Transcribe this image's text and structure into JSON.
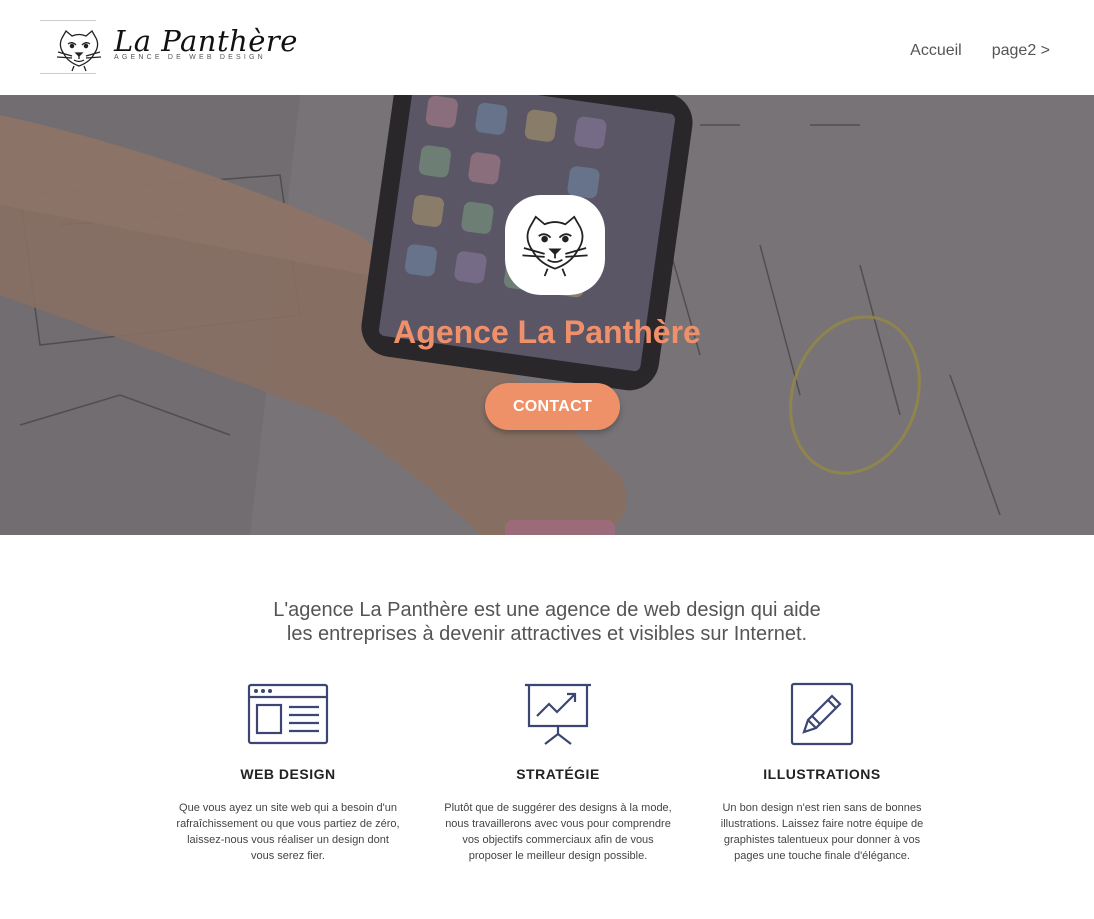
{
  "brand": {
    "name": "La Panthère",
    "tagline": "AGENCE DE WEB DESIGN"
  },
  "nav": {
    "items": [
      {
        "label": "Accueil"
      },
      {
        "label": "page2 >"
      }
    ]
  },
  "hero": {
    "title": "Agence La Panthère",
    "button_label": "CONTACT"
  },
  "intro": {
    "line1": "L'agence La Panthère est une agence de web design qui aide",
    "line2": "les entreprises à devenir attractives et visibles sur Internet."
  },
  "features": [
    {
      "icon": "browser-window-icon",
      "title": "WEB DESIGN",
      "text": "Que vous ayez un site web qui a besoin d'un rafraîchissement ou que vous partiez de zéro, laissez-nous vous réaliser un design dont vous serez fier."
    },
    {
      "icon": "presentation-chart-icon",
      "title": "STRATÉGIE",
      "text": "Plutôt que de suggérer des designs à la mode, nous travaillerons avec vous pour comprendre vos objectifs commerciaux afin de vous proposer le meilleur design possible."
    },
    {
      "icon": "pencil-square-icon",
      "title": "ILLUSTRATIONS",
      "text": "Un bon design n'est rien sans de bonnes illustrations. Laissez faire notre équipe de graphistes talentueux pour donner à vos pages une touche finale d'élégance."
    }
  ],
  "colors": {
    "accent": "#ee9068",
    "icon": "#3c4672"
  }
}
